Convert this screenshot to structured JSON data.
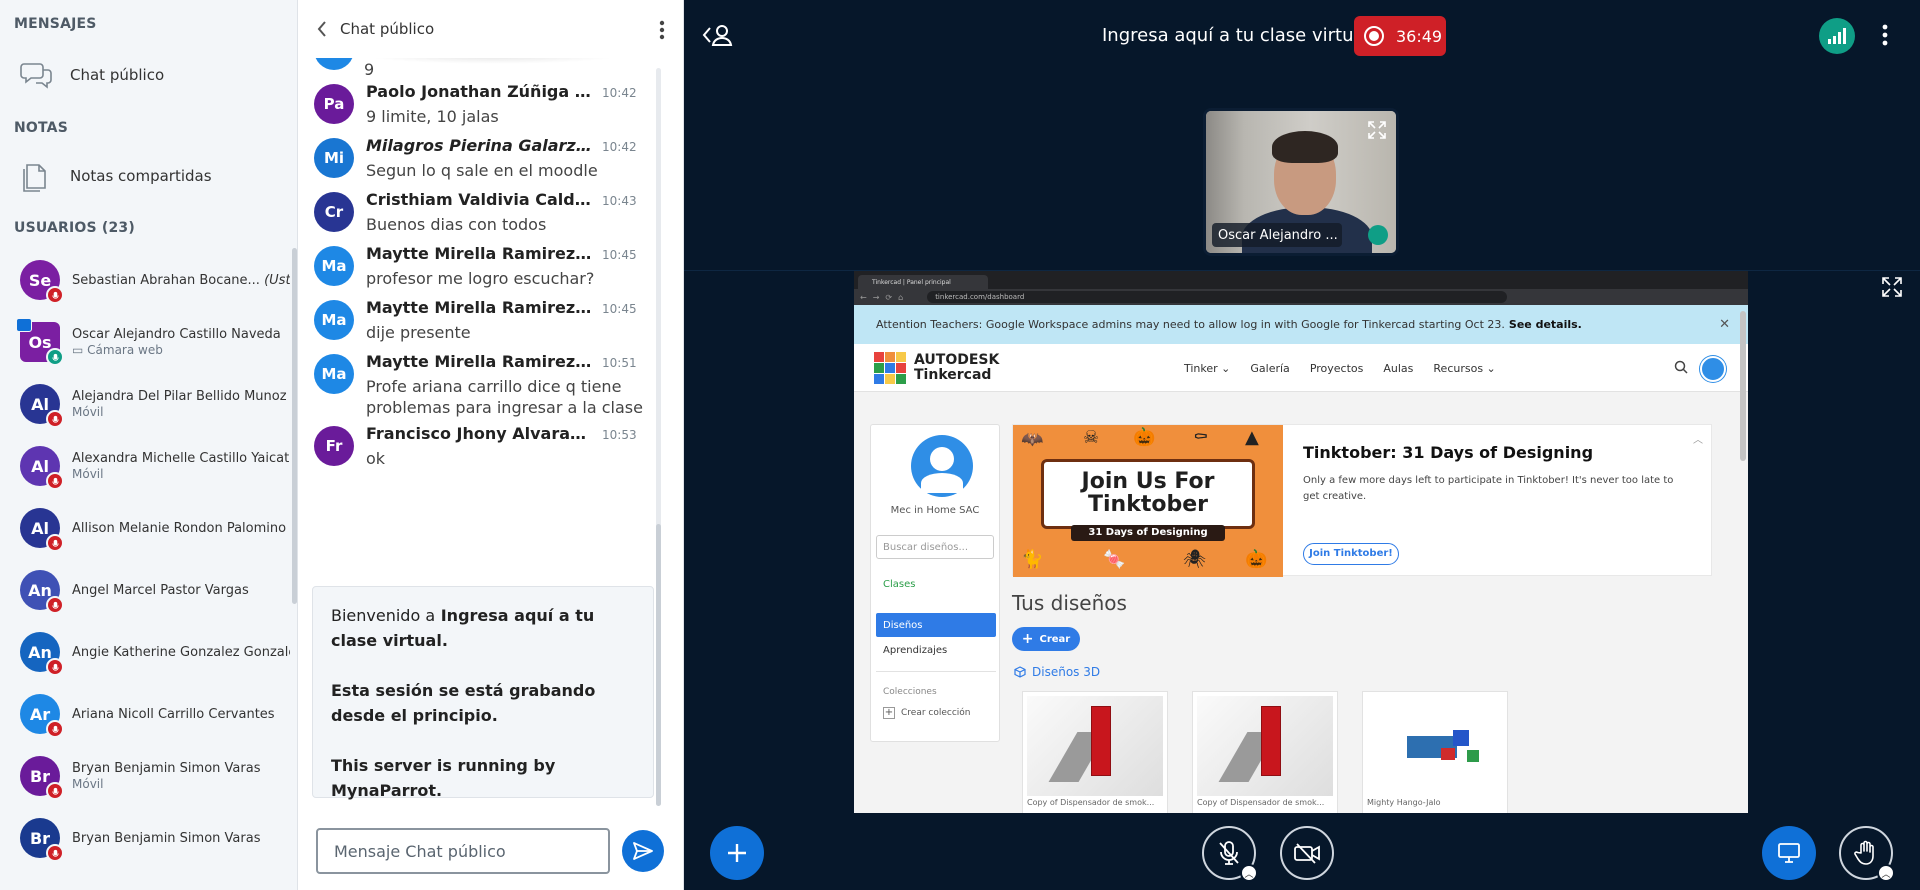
{
  "left_panel": {
    "messages_title": "MENSAJES",
    "public_chat_label": "Chat público",
    "notes_title": "NOTAS",
    "shared_notes_label": "Notas compartidas",
    "users_title": "USUARIOS (23)",
    "users": [
      {
        "initials": "Se",
        "name": "Sebastian Abrahan Bocane...",
        "you_tag": "(Usted)",
        "sub": "",
        "color": "#7b1fa2"
      },
      {
        "initials": "Os",
        "name": "Oscar Alejandro Castillo Naveda",
        "you_tag": "",
        "sub": "Cámara web",
        "color": "#7b1fa2"
      },
      {
        "initials": "Al",
        "name": "Alejandra Del Pilar Bellido Munoz",
        "you_tag": "",
        "sub": "Móvil",
        "color": "#283593"
      },
      {
        "initials": "Al",
        "name": "Alexandra Michelle Castillo Yaicate",
        "you_tag": "",
        "sub": "Móvil",
        "color": "#5e35b1"
      },
      {
        "initials": "Al",
        "name": "Allison Melanie Rondon Palomino",
        "you_tag": "",
        "sub": "",
        "color": "#283593"
      },
      {
        "initials": "An",
        "name": "Angel Marcel Pastor Vargas",
        "you_tag": "",
        "sub": "",
        "color": "#3f51b5"
      },
      {
        "initials": "An",
        "name": "Angie Katherine Gonzalez Gonzales",
        "you_tag": "",
        "sub": "",
        "color": "#1565c0"
      },
      {
        "initials": "Ar",
        "name": "Ariana Nicoll Carrillo Cervantes",
        "you_tag": "",
        "sub": "",
        "color": "#1e88e5"
      },
      {
        "initials": "Br",
        "name": "Bryan Benjamin Simon Varas",
        "you_tag": "",
        "sub": "Móvil",
        "color": "#6a1b9a"
      },
      {
        "initials": "Br",
        "name": "Bryan Benjamin Simon Varas",
        "you_tag": "",
        "sub": "",
        "color": "#1a3a8f"
      }
    ]
  },
  "chat": {
    "header_title": "Chat público",
    "partial_top_text": "9",
    "messages": [
      {
        "initials": "Pa",
        "name": "Paolo Jonathan Zúñiga Prado",
        "italic": false,
        "time": "10:42",
        "text": "9 limite, 10 jalas",
        "color": "#6a1b9a"
      },
      {
        "initials": "Mi",
        "name": "Milagros Pierina Galarza Co...",
        "italic": true,
        "time": "10:42",
        "text": "Segun lo q sale en el moodle",
        "color": "#1976d2"
      },
      {
        "initials": "Cr",
        "name": "Cristhiam Valdivia Calderon",
        "italic": false,
        "time": "10:43",
        "text": "Buenos dias con todos",
        "color": "#283593"
      },
      {
        "initials": "Ma",
        "name": "Maytte Mirella Ramirez Rod...",
        "italic": false,
        "time": "10:45",
        "text": "profesor me logro escuchar?",
        "color": "#1e88e5"
      },
      {
        "initials": "Ma",
        "name": "Maytte Mirella Ramirez Rod...",
        "italic": false,
        "time": "10:45",
        "text": "dije presente",
        "color": "#1e88e5"
      },
      {
        "initials": "Ma",
        "name": "Maytte Mirella Ramirez Rod...",
        "italic": false,
        "time": "10:51",
        "text": "Profe ariana carrillo dice q tiene problemas para ingresar a la clase",
        "color": "#1e88e5"
      },
      {
        "initials": "Fr",
        "name": "Francisco Jhony Alvarado ...",
        "italic": false,
        "time": "10:53",
        "text": "ok",
        "color": "#6a1b9a"
      }
    ],
    "welcome": {
      "line1_prefix": "Bienvenido a",
      "line1_title": "Ingresa aquí a tu clase virtual.",
      "line2": "Esta sesión se está grabando desde el principio.",
      "line3": "This server is running by MynaParrot."
    },
    "input_placeholder": "Mensaje Chat público"
  },
  "main": {
    "meeting_title": "Ingresa aquí a tu clase virtual",
    "recording_time": "36:49",
    "webcam_name": "Oscar Alejandro ...",
    "colors": {
      "primary": "#0f70d7",
      "recording": "#cf2027",
      "connection": "#0f9e86",
      "background": "#06172a"
    }
  },
  "browser": {
    "tab_title": "Tinkercad | Panel principal",
    "url": "tinkercad.com/dashboard",
    "banner_text": "Attention Teachers: Google Workspace admins may need to allow log in with Google for Tinkercad starting Oct 23.",
    "banner_link": "See details.",
    "brand_line1": "AUTODESK",
    "brand_line2": "Tinkercad",
    "nav": [
      "Tinker ⌄",
      "Galería",
      "Proyectos",
      "Aulas",
      "Recursos ⌄"
    ],
    "company": "Mec in Home SAC",
    "search_placeholder": "Buscar diseños...",
    "sidebar_clases": "Clases",
    "sidebar_disenos": "Diseños",
    "sidebar_aprendizajes": "Aprendizajes",
    "sidebar_colecciones": "Colecciones",
    "sidebar_crear_coleccion": "Crear colección",
    "promo_image_title": "Join Us For Tinktober",
    "promo_image_sub": "31 Days of Designing",
    "promo_heading": "Tinktober: 31 Days of Designing",
    "promo_text": "Only a few more days left to participate in Tinktober! It's never too late to get creative.",
    "promo_button": "Join Tinktober!",
    "tus_disenos": "Tus diseños",
    "crear_button": "Crear",
    "disenos_3d": "Diseños 3D",
    "cards": [
      {
        "caption": "Copy of Dispensador de smok..."
      },
      {
        "caption": "Copy of Dispensador de smok..."
      },
      {
        "caption": "Mighty Hango-Jalo"
      }
    ]
  }
}
